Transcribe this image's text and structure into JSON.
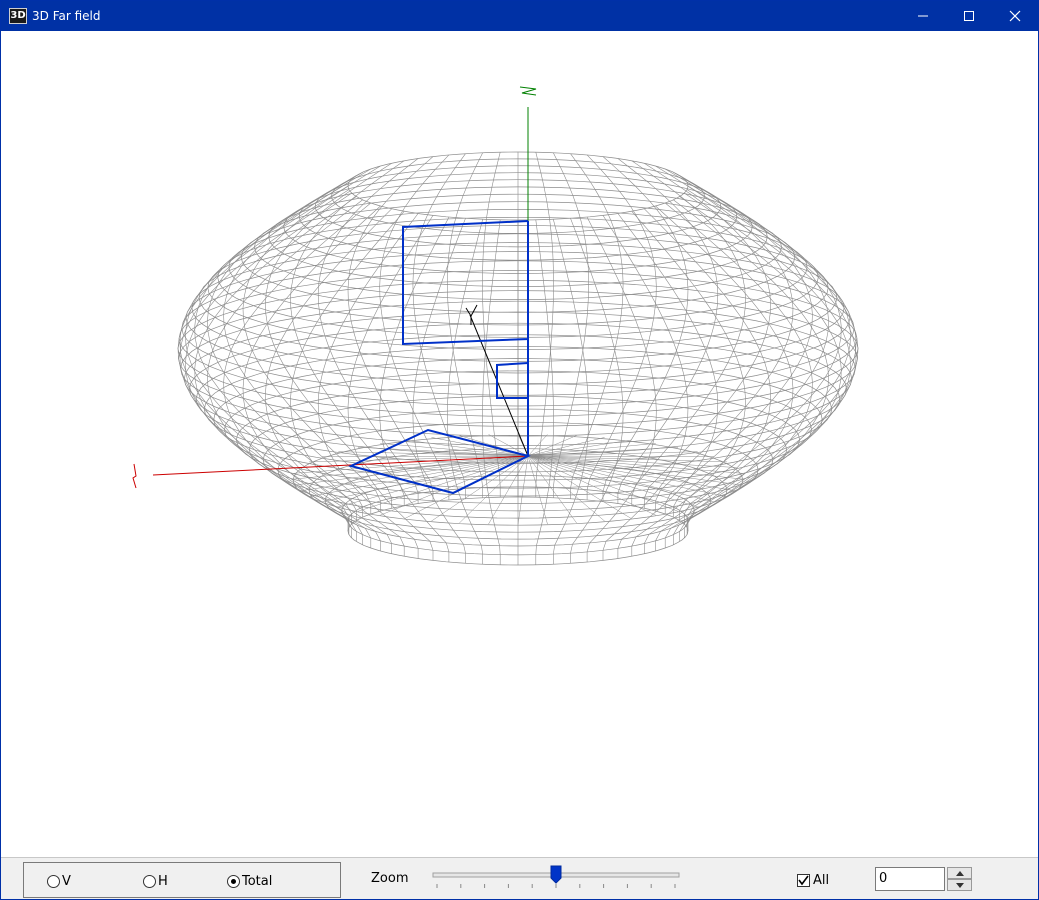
{
  "window": {
    "title": "3D Far field",
    "icon_label": "3D",
    "title_bar_color": "#0031a5"
  },
  "title_buttons": {
    "minimize_icon": "minimize-icon",
    "maximize_icon": "maximize-icon",
    "close_icon": "close-icon"
  },
  "viewport": {
    "axis_labels": {
      "x": "X",
      "y": "Y",
      "z": "Z"
    },
    "axis_colors": {
      "x": "#cc0000",
      "y": "#000000",
      "z": "#008000"
    },
    "mesh_color": "#8c8c8c",
    "antenna_color": "#0030c8"
  },
  "controls": {
    "mode_options": [
      {
        "label": "V",
        "selected": false
      },
      {
        "label": "H",
        "selected": false
      },
      {
        "label": "Total",
        "selected": true
      }
    ],
    "zoom_label": "Zoom",
    "zoom_level": 0.5,
    "all_label": "All",
    "all_checked": true,
    "value": "0"
  }
}
